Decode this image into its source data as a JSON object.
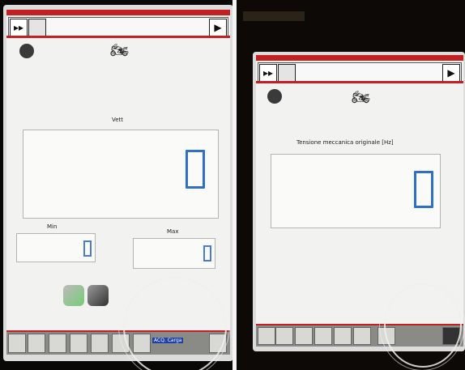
{
  "left_photo": {
    "window_title": "",
    "forward_label": "▸▸",
    "play_label": "▶",
    "value_label": "Vett",
    "main_value": "0",
    "min_label": "Min",
    "max_label": "Max",
    "min_value": "0",
    "max_value": "0",
    "hint_text": "ACQ. Carga"
  },
  "right_photo": {
    "window_title": "",
    "forward_label": "▸▸",
    "play_label": "▶",
    "value_label": "Tensione meccanica originale [Hz]",
    "main_value": "0"
  },
  "colors": {
    "accent_red": "#c42022",
    "digit_blue": "#2e6fc8"
  }
}
